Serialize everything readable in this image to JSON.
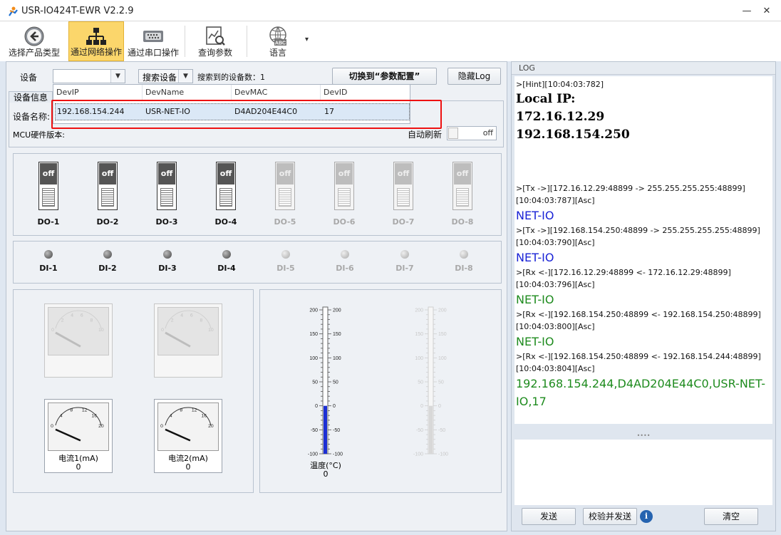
{
  "window": {
    "title": "USR-IO424T-EWR V2.2.9",
    "min_glyph": "—",
    "close_glyph": "✕"
  },
  "toolbar": {
    "items": [
      {
        "label": "选择产品类型"
      },
      {
        "label": "通过网络操作"
      },
      {
        "label": "通过串口操作"
      },
      {
        "label": "查询参数"
      },
      {
        "label": "语言"
      }
    ],
    "lang_icon_text": "ABC",
    "more_glyph": "▾"
  },
  "device_bar": {
    "device_label": "设备",
    "device_value": "",
    "search_button": "搜索设备",
    "found_label": "搜索到的设备数：",
    "found_count": "1",
    "switch_button": "切换到“参数配置”",
    "hide_log_button": "隐藏Log",
    "arrow_glyph": "▼"
  },
  "device_list": {
    "headers": [
      "DevIP",
      "DevName",
      "DevMAC",
      "DevID"
    ],
    "rows": [
      {
        "ip": "192.168.154.244",
        "name": "USR-NET-IO",
        "mac": "D4AD204E44C0",
        "id": "17"
      }
    ]
  },
  "device_info": {
    "tab_label": "设备信息",
    "name_label": "设备名称:",
    "mcu_label": "MCU硬件版本:",
    "auto_refresh_label": "自动刷新",
    "auto_refresh_state": "off"
  },
  "outputs": [
    {
      "label": "DO-1",
      "state": "off",
      "enabled": true
    },
    {
      "label": "DO-2",
      "state": "off",
      "enabled": true
    },
    {
      "label": "DO-3",
      "state": "off",
      "enabled": true
    },
    {
      "label": "DO-4",
      "state": "off",
      "enabled": true
    },
    {
      "label": "DO-5",
      "state": "off",
      "enabled": false
    },
    {
      "label": "DO-6",
      "state": "off",
      "enabled": false
    },
    {
      "label": "DO-7",
      "state": "off",
      "enabled": false
    },
    {
      "label": "DO-8",
      "state": "off",
      "enabled": false
    }
  ],
  "inputs": [
    {
      "label": "DI-1",
      "enabled": true
    },
    {
      "label": "DI-2",
      "enabled": true
    },
    {
      "label": "DI-3",
      "enabled": true
    },
    {
      "label": "DI-4",
      "enabled": true
    },
    {
      "label": "DI-5",
      "enabled": false
    },
    {
      "label": "DI-6",
      "enabled": false
    },
    {
      "label": "DI-7",
      "enabled": false
    },
    {
      "label": "DI-8",
      "enabled": false
    }
  ],
  "gauges": {
    "disabled_ticks": [
      "0",
      "2",
      "4",
      "6",
      "8",
      "10"
    ],
    "current_ticks": [
      "0",
      "4",
      "8",
      "12",
      "16",
      "20"
    ],
    "current1": {
      "label": "电流1(mA)",
      "value": "0"
    },
    "current2": {
      "label": "电流2(mA)",
      "value": "0"
    }
  },
  "thermometer": {
    "ticks": [
      "200",
      "150",
      "100",
      "50",
      "0",
      "-50",
      "-100"
    ],
    "label": "温度(°C)",
    "value": "0",
    "range": [
      -100,
      200
    ],
    "reading": 0
  },
  "log": {
    "header": "LOG",
    "lines": [
      {
        "text": ">[Hint][10:04:03:782]",
        "style": "small",
        "color": "#111111"
      },
      {
        "text": "Local IP:",
        "style": "bold",
        "color": "#000000"
      },
      {
        "text": "172.16.12.29",
        "style": "bold",
        "color": "#000000"
      },
      {
        "text": "192.168.154.250",
        "style": "bold",
        "color": "#000000"
      },
      {
        "text": "",
        "style": "gap",
        "color": "#000000"
      },
      {
        "text": ">[Tx ->][172.16.12.29:48899 -> 255.255.255.255:48899][10:04:03:787][Asc]",
        "style": "small",
        "color": "#111111"
      },
      {
        "text": "NET-IO",
        "style": "big",
        "color": "#1a23d6"
      },
      {
        "text": ">[Tx ->][192.168.154.250:48899 -> 255.255.255.255:48899][10:04:03:790][Asc]",
        "style": "small",
        "color": "#111111"
      },
      {
        "text": "NET-IO",
        "style": "big",
        "color": "#1a23d6"
      },
      {
        "text": ">[Rx <-][172.16.12.29:48899 <- 172.16.12.29:48899][10:04:03:796][Asc]",
        "style": "small",
        "color": "#111111"
      },
      {
        "text": "NET-IO",
        "style": "big",
        "color": "#1e8b1e"
      },
      {
        "text": ">[Rx <-][192.168.154.250:48899 <- 192.168.154.250:48899][10:04:03:800][Asc]",
        "style": "small",
        "color": "#111111"
      },
      {
        "text": "NET-IO",
        "style": "big",
        "color": "#1e8b1e"
      },
      {
        "text": ">[Rx <-][192.168.154.250:48899 <- 192.168.154.244:48899][10:04:03:804][Asc]",
        "style": "small",
        "color": "#111111"
      },
      {
        "text": "192.168.154.244,D4AD204E44C0,USR-NET-IO,17",
        "style": "big",
        "color": "#1e8b1e"
      }
    ],
    "splitter_glyph": "••••",
    "send_button": "发送",
    "verify_send_button": "校验并发送",
    "info_glyph": "i",
    "clear_button": "清空"
  },
  "colors": {
    "accent_active": "#fbd66b",
    "highlight_box": "#ee1111",
    "info_icon": "#2563b0",
    "tx_text": "#1a23d6",
    "rx_text": "#1e8b1e"
  }
}
